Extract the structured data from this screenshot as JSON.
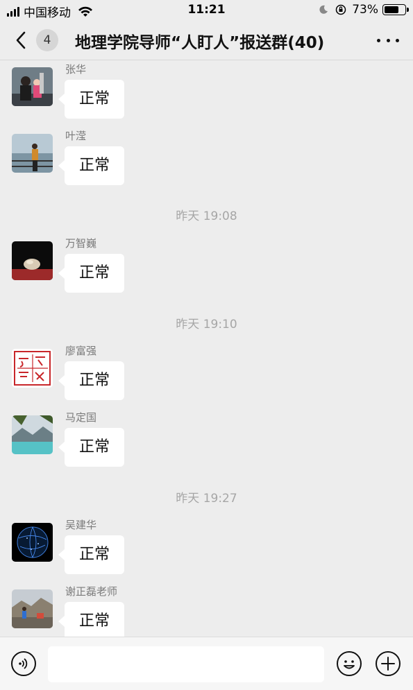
{
  "status_bar": {
    "carrier": "中国移动",
    "time": "11:21",
    "battery": "73%",
    "battery_level": 0.73
  },
  "nav": {
    "unread_count": "4",
    "title": "地理学院导师“人盯人”报送群(40)"
  },
  "messages": [
    {
      "type": "message",
      "sender": "张华",
      "text": "正常",
      "avatar": "avatar-photo-parent-child"
    },
    {
      "type": "message",
      "sender": "叶滢",
      "text": "正常",
      "avatar": "avatar-photo-seaside"
    },
    {
      "type": "time",
      "text": "昨天 19:08"
    },
    {
      "type": "message",
      "sender": "万智巍",
      "text": "正常",
      "avatar": "avatar-photo-stone"
    },
    {
      "type": "time",
      "text": "昨天 19:10"
    },
    {
      "type": "message",
      "sender": "廖富强",
      "text": "正常",
      "avatar": "avatar-seal-stamp"
    },
    {
      "type": "message",
      "sender": "马定国",
      "text": "正常",
      "avatar": "avatar-photo-lake"
    },
    {
      "type": "time",
      "text": "昨天 19:27"
    },
    {
      "type": "message",
      "sender": "吴建华",
      "text": "正常",
      "avatar": "avatar-photo-globe"
    },
    {
      "type": "message",
      "sender": "谢正磊老师",
      "text": "正常",
      "avatar": "avatar-photo-mountain"
    }
  ],
  "bottom_bar": {
    "voice_icon": "voice-icon",
    "emoji_icon": "emoji-icon",
    "plus_icon": "plus-icon"
  }
}
